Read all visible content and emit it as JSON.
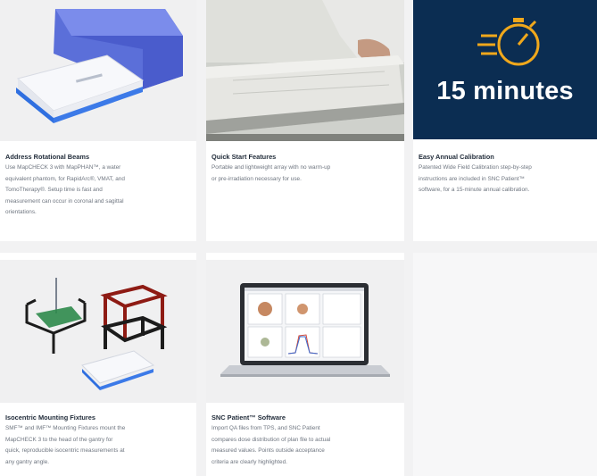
{
  "cards": [
    {
      "title": "Address Rotational Beams",
      "desc_lines": [
        "Use MapCHECK 3 with MapPHAN™, a water",
        "equivalent phantom, for RapidArc®, VMAT, and",
        "TomoTherapy®. Setup time is fast and",
        "measurement can occur in coronal and sagittal",
        "orientations."
      ],
      "image": "mapcheck-device-with-phantom"
    },
    {
      "title": "Quick Start Features",
      "desc_lines": [
        "Portable and lightweight array with no warm-up",
        "or pre-irradiation necessary for use."
      ],
      "image": "hand-on-device-photo"
    },
    {
      "title": "Easy Annual Calibration",
      "desc_lines": [
        "Patented Wide Field Calibration step-by-step",
        "instructions are included in SNC Patient™",
        "software, for a 15-minute annual calibration."
      ],
      "image": "stopwatch-icon",
      "image_text": "15 minutes",
      "colors": {
        "bg": "#0b2d52",
        "accent": "#f0a81c"
      }
    },
    {
      "title": "Isocentric Mounting Fixtures",
      "desc_lines": [
        "SMF™ and IMF™ Mounting Fixtures mount the",
        "MapCHECK 3 to the head of the gantry for",
        "quick, reproducible isocentric measurements at",
        "any gantry angle."
      ],
      "image": "mounting-fixtures"
    },
    {
      "title": "SNC Patient™ Software",
      "desc_lines": [
        "Import QA files from TPS, and SNC Patient",
        "compares dose distribution of plan file to actual",
        "measured values. Points outside acceptance",
        "criteria are clearly highlighted."
      ],
      "image": "laptop-software"
    }
  ]
}
